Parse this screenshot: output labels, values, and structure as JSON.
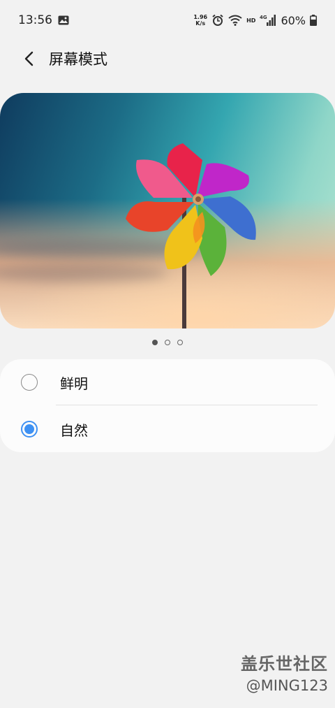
{
  "status_bar": {
    "time": "13:56",
    "net_speed_top": "1.96",
    "net_speed_bottom": "K/s",
    "hd_label": "HD",
    "network_label": "4G",
    "battery": "60%",
    "icons": [
      "gallery-icon",
      "alarm-icon",
      "wifi-icon",
      "signal-icon",
      "battery-icon"
    ]
  },
  "header": {
    "title": "屏幕模式"
  },
  "preview": {
    "description_icon": "pinwheel-image",
    "page_count": 3,
    "active_page": 1
  },
  "options": [
    {
      "label": "鲜明",
      "selected": false
    },
    {
      "label": "自然",
      "selected": true
    }
  ],
  "watermark": {
    "title": "盖乐世社区",
    "user": "@MING123"
  },
  "colors": {
    "accent": "#3e91f3",
    "background": "#f2f2f2",
    "card": "#fcfcfc"
  }
}
